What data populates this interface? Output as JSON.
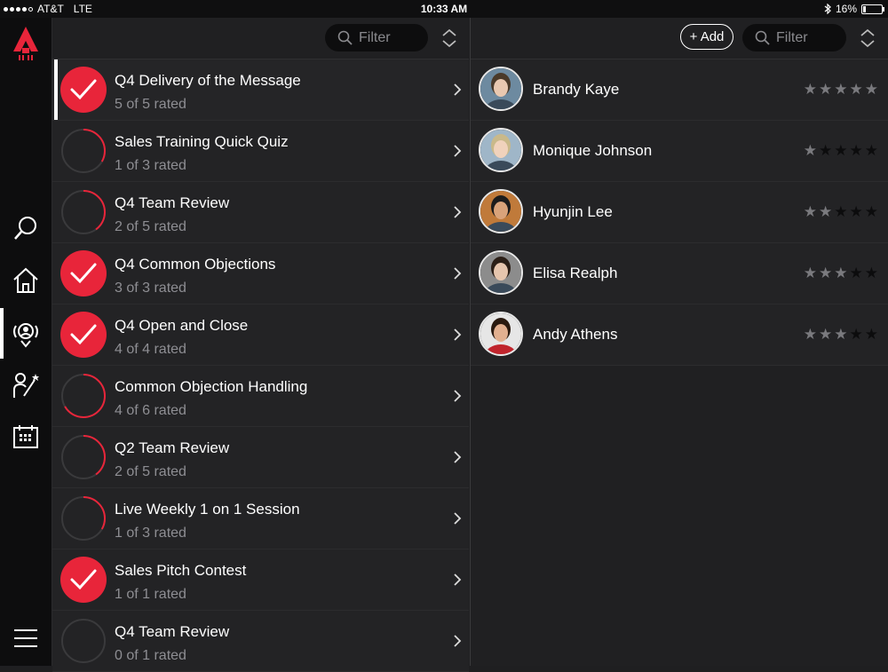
{
  "status_bar": {
    "carrier": "AT&T",
    "network": "LTE",
    "time": "10:33 AM",
    "battery": "16%",
    "battery_level": 0.16,
    "bluetooth_icon": "bluetooth-icon"
  },
  "nav": {
    "logo_icon": "app-logo-icon",
    "items": [
      {
        "icon": "search-icon"
      },
      {
        "icon": "home-icon"
      },
      {
        "icon": "coaching-icon",
        "active": true
      },
      {
        "icon": "skills-wand-icon"
      },
      {
        "icon": "calendar-icon"
      },
      {
        "icon": "menu-icon"
      }
    ]
  },
  "left_pane": {
    "filter_placeholder": "Filter",
    "items": [
      {
        "title": "Q4 Delivery of the Message",
        "subtitle": "5 of 5 rated",
        "rated": 5,
        "total": 5
      },
      {
        "title": "Sales Training Quick Quiz",
        "subtitle": "1 of 3 rated",
        "rated": 1,
        "total": 3
      },
      {
        "title": "Q4 Team Review",
        "subtitle": "2 of 5 rated",
        "rated": 2,
        "total": 5
      },
      {
        "title": "Q4 Common Objections",
        "subtitle": "3 of 3 rated",
        "rated": 3,
        "total": 3
      },
      {
        "title": "Q4 Open and Close",
        "subtitle": "4 of 4 rated",
        "rated": 4,
        "total": 4
      },
      {
        "title": "Common Objection Handling",
        "subtitle": "4 of 6 rated",
        "rated": 4,
        "total": 6
      },
      {
        "title": "Q2 Team Review",
        "subtitle": "2 of 5 rated",
        "rated": 2,
        "total": 5
      },
      {
        "title": "Live Weekly 1 on 1 Session",
        "subtitle": "1 of 3 rated",
        "rated": 1,
        "total": 3
      },
      {
        "title": "Sales Pitch Contest",
        "subtitle": "1 of 1 rated",
        "rated": 1,
        "total": 1
      },
      {
        "title": "Q4 Team Review",
        "subtitle": "0 of 1 rated",
        "rated": 0,
        "total": 1
      }
    ]
  },
  "right_pane": {
    "add_label": "+ Add",
    "filter_placeholder": "Filter",
    "people": [
      {
        "name": "Brandy Kaye",
        "rating": 5
      },
      {
        "name": "Monique Johnson",
        "rating": 1
      },
      {
        "name": "Hyunjin Lee",
        "rating": 2
      },
      {
        "name": "Elisa Realph",
        "rating": 3
      },
      {
        "name": "Andy Athens",
        "rating": 3
      }
    ]
  },
  "colors": {
    "accent": "#e8253a",
    "background": "#202022",
    "rail": "#0d0d0e",
    "subtext": "#8e8e93"
  }
}
